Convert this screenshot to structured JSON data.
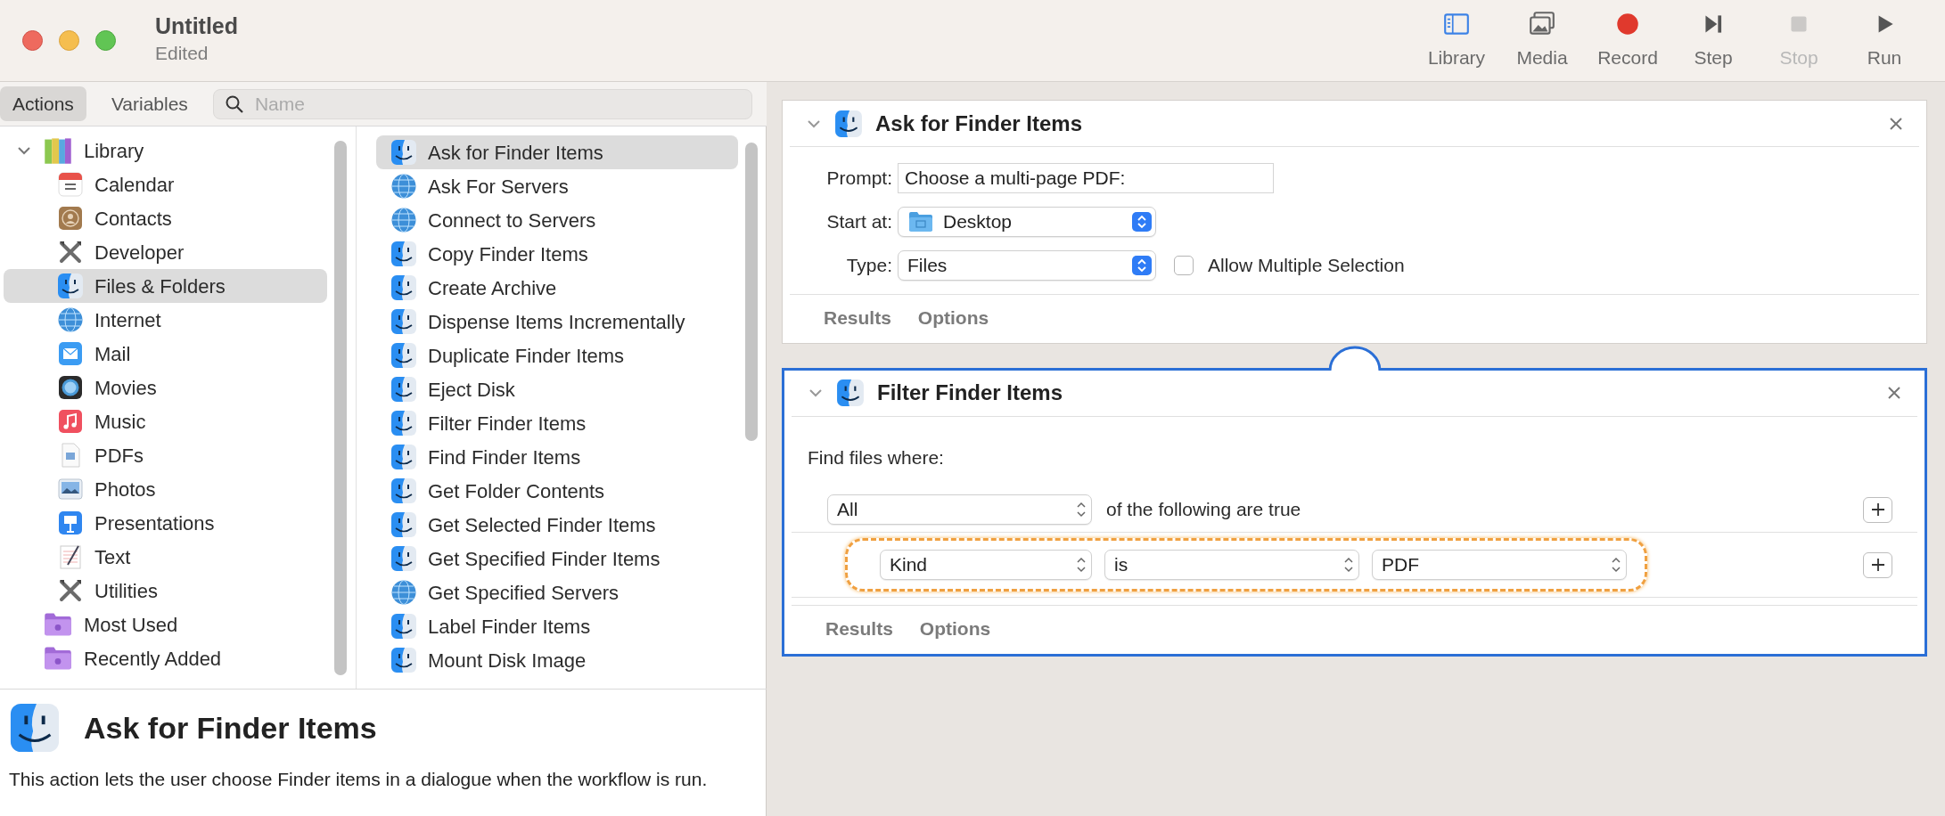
{
  "window": {
    "title": "Untitled",
    "subtitle": "Edited"
  },
  "toolbar": [
    {
      "kind": "library",
      "label": "Library",
      "disabled": false
    },
    {
      "kind": "media",
      "label": "Media",
      "disabled": false
    },
    {
      "kind": "record",
      "label": "Record",
      "disabled": false
    },
    {
      "kind": "step",
      "label": "Step",
      "disabled": false
    },
    {
      "kind": "stop",
      "label": "Stop",
      "disabled": true
    },
    {
      "kind": "run",
      "label": "Run",
      "disabled": false
    }
  ],
  "sidebar": {
    "tabs": [
      {
        "label": "Actions",
        "selected": true
      },
      {
        "label": "Variables",
        "selected": false
      }
    ],
    "search": {
      "placeholder": "Name"
    }
  },
  "categories": [
    {
      "kind": "library",
      "label": "Library",
      "selected": false,
      "expanded": true,
      "children": [
        {
          "kind": "calendar",
          "label": "Calendar",
          "selected": false
        },
        {
          "kind": "contacts",
          "label": "Contacts",
          "selected": false
        },
        {
          "kind": "tools",
          "label": "Developer",
          "selected": false
        },
        {
          "kind": "finder",
          "label": "Files & Folders",
          "selected": true
        },
        {
          "kind": "globe",
          "label": "Internet",
          "selected": false
        },
        {
          "kind": "mail",
          "label": "Mail",
          "selected": false
        },
        {
          "kind": "movies",
          "label": "Movies",
          "selected": false
        },
        {
          "kind": "music",
          "label": "Music",
          "selected": false
        },
        {
          "kind": "pdf",
          "label": "PDFs",
          "selected": false
        },
        {
          "kind": "photos",
          "label": "Photos",
          "selected": false
        },
        {
          "kind": "presentation",
          "label": "Presentations",
          "selected": false
        },
        {
          "kind": "text",
          "label": "Text",
          "selected": false
        },
        {
          "kind": "tools",
          "label": "Utilities",
          "selected": false
        }
      ]
    },
    {
      "kind": "folder",
      "label": "Most Used",
      "selected": false
    },
    {
      "kind": "folder",
      "label": "Recently Added",
      "selected": false
    }
  ],
  "actions": [
    {
      "kind": "finder",
      "label": "Ask for Finder Items",
      "selected": true
    },
    {
      "kind": "globe",
      "label": "Ask For Servers",
      "selected": false
    },
    {
      "kind": "globe",
      "label": "Connect to Servers",
      "selected": false
    },
    {
      "kind": "finder",
      "label": "Copy Finder Items",
      "selected": false
    },
    {
      "kind": "finder",
      "label": "Create Archive",
      "selected": false
    },
    {
      "kind": "finder",
      "label": "Dispense Items Incrementally",
      "selected": false
    },
    {
      "kind": "finder",
      "label": "Duplicate Finder Items",
      "selected": false
    },
    {
      "kind": "finder",
      "label": "Eject Disk",
      "selected": false
    },
    {
      "kind": "finder",
      "label": "Filter Finder Items",
      "selected": false
    },
    {
      "kind": "finder",
      "label": "Find Finder Items",
      "selected": false
    },
    {
      "kind": "finder",
      "label": "Get Folder Contents",
      "selected": false
    },
    {
      "kind": "finder",
      "label": "Get Selected Finder Items",
      "selected": false
    },
    {
      "kind": "finder",
      "label": "Get Specified Finder Items",
      "selected": false
    },
    {
      "kind": "globe",
      "label": "Get Specified Servers",
      "selected": false
    },
    {
      "kind": "finder",
      "label": "Label Finder Items",
      "selected": false
    },
    {
      "kind": "finder",
      "label": "Mount Disk Image",
      "selected": false
    }
  ],
  "description": {
    "title": "Ask for Finder Items",
    "text": "This action lets the user choose Finder items in a dialogue when the workflow is run."
  },
  "workflow": [
    {
      "title": "Ask for Finder Items",
      "selected": false,
      "rows": [
        {
          "kind": "text",
          "label": "Prompt:",
          "value": "Choose a multi-page PDF:"
        },
        {
          "kind": "popup",
          "label": "Start at:",
          "value": "Desktop",
          "folder_icon": true
        },
        {
          "kind": "popup",
          "label": "Type:",
          "value": "Files",
          "checkbox": {
            "label": "Allow Multiple Selection",
            "checked": false
          }
        }
      ],
      "footer": [
        "Results",
        "Options"
      ]
    },
    {
      "title": "Filter Finder Items",
      "selected": true,
      "intro": "Find files where:",
      "match": {
        "value": "All",
        "text": "of the following are true"
      },
      "conditions": [
        {
          "fields": [
            "Kind",
            "is",
            "PDF"
          ],
          "highlighted": true
        }
      ],
      "footer": [
        "Results",
        "Options"
      ]
    }
  ]
}
